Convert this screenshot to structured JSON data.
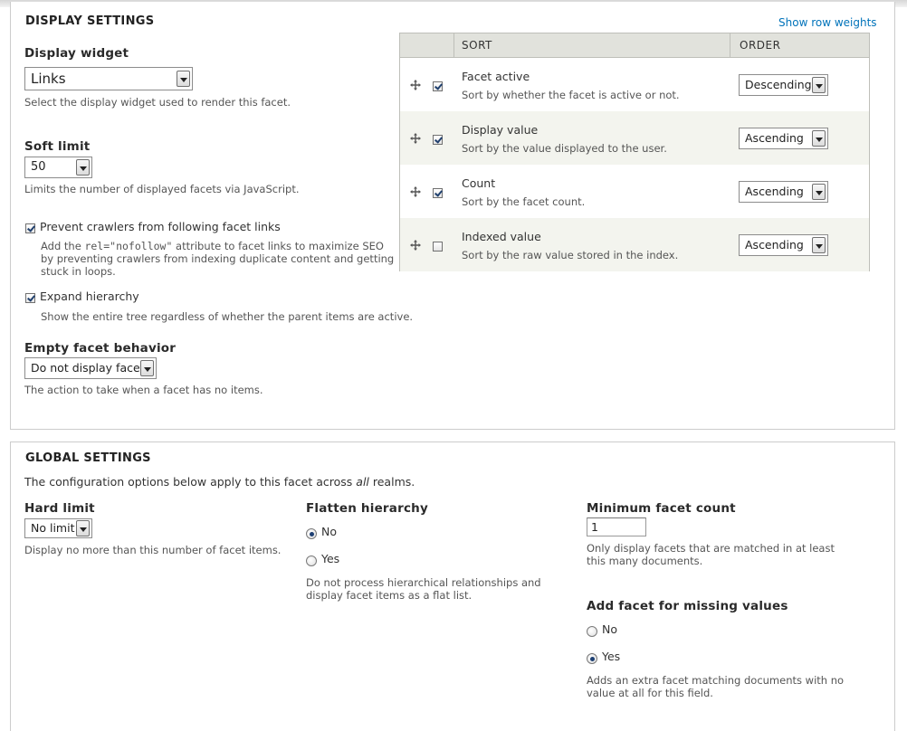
{
  "display_settings": {
    "legend": "DISPLAY SETTINGS",
    "show_row_weights": "Show row weights",
    "display_widget": {
      "label": "Display widget",
      "value": "Links",
      "description": "Select the display widget used to render this facet."
    },
    "soft_limit": {
      "label": "Soft limit",
      "value": "50",
      "description": "Limits the number of displayed facets via JavaScript."
    },
    "prevent_crawlers": {
      "checked": true,
      "label": "Prevent crawlers from following facet links",
      "desc_before": "Add the ",
      "desc_code": "rel=\"nofollow\"",
      "desc_after": " attribute to facet links to maximize SEO",
      "desc_line2": "by preventing crawlers from indexing duplicate content and getting",
      "desc_line3": "stuck in loops."
    },
    "expand_hierarchy": {
      "checked": true,
      "label": "Expand hierarchy",
      "description": "Show the entire tree regardless of whether the parent items are active."
    },
    "empty_facet": {
      "label": "Empty facet behavior",
      "value": "Do not display facet",
      "description": "The action to take when a facet has no items."
    },
    "sort_table": {
      "headers": {
        "sort": "SORT",
        "order": "ORDER"
      },
      "rows": [
        {
          "title": "Facet active",
          "description": "Sort by whether the facet is active or not.",
          "checked": true,
          "order": "Descending"
        },
        {
          "title": "Display value",
          "description": "Sort by the value displayed to the user.",
          "checked": true,
          "order": "Ascending"
        },
        {
          "title": "Count",
          "description": "Sort by the facet count.",
          "checked": true,
          "order": "Ascending"
        },
        {
          "title": "Indexed value",
          "description": "Sort by the raw value stored in the index.",
          "checked": false,
          "order": "Ascending"
        }
      ]
    }
  },
  "global_settings": {
    "legend": "GLOBAL SETTINGS",
    "intro_before": "The configuration options below apply to this facet across ",
    "intro_em": "all",
    "intro_after": " realms.",
    "hard_limit": {
      "label": "Hard limit",
      "value": "No limit",
      "description": "Display no more than this number of facet items."
    },
    "flatten_hierarchy": {
      "label": "Flatten hierarchy",
      "options": [
        {
          "label": "No",
          "selected": true
        },
        {
          "label": "Yes",
          "selected": false
        }
      ],
      "desc_line1": "Do not process hierarchical relationships and",
      "desc_line2": "display facet items as a flat list."
    },
    "min_facet_count": {
      "label": "Minimum facet count",
      "value": "1",
      "desc_line1": "Only display facets that are matched in at least",
      "desc_line2": "this many documents."
    },
    "missing_values": {
      "label": "Add facet for missing values",
      "options": [
        {
          "label": "No",
          "selected": false
        },
        {
          "label": "Yes",
          "selected": true
        }
      ],
      "desc_line1": "Adds an extra facet matching documents with no",
      "desc_line2": "value at all for this field."
    }
  }
}
